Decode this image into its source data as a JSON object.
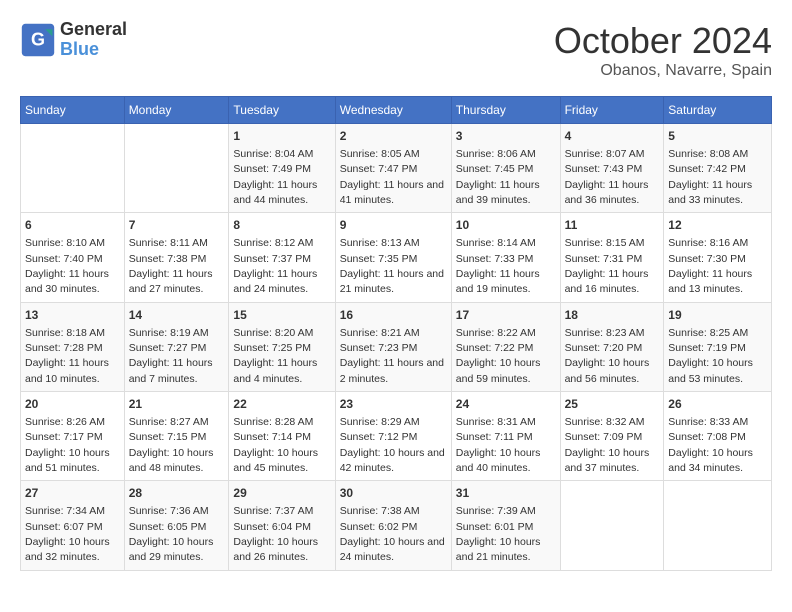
{
  "logo": {
    "line1": "General",
    "line2": "Blue"
  },
  "title": "October 2024",
  "location": "Obanos, Navarre, Spain",
  "days_of_week": [
    "Sunday",
    "Monday",
    "Tuesday",
    "Wednesday",
    "Thursday",
    "Friday",
    "Saturday"
  ],
  "weeks": [
    [
      {
        "day": "",
        "info": ""
      },
      {
        "day": "",
        "info": ""
      },
      {
        "day": "1",
        "info": "Sunrise: 8:04 AM\nSunset: 7:49 PM\nDaylight: 11 hours and 44 minutes."
      },
      {
        "day": "2",
        "info": "Sunrise: 8:05 AM\nSunset: 7:47 PM\nDaylight: 11 hours and 41 minutes."
      },
      {
        "day": "3",
        "info": "Sunrise: 8:06 AM\nSunset: 7:45 PM\nDaylight: 11 hours and 39 minutes."
      },
      {
        "day": "4",
        "info": "Sunrise: 8:07 AM\nSunset: 7:43 PM\nDaylight: 11 hours and 36 minutes."
      },
      {
        "day": "5",
        "info": "Sunrise: 8:08 AM\nSunset: 7:42 PM\nDaylight: 11 hours and 33 minutes."
      }
    ],
    [
      {
        "day": "6",
        "info": "Sunrise: 8:10 AM\nSunset: 7:40 PM\nDaylight: 11 hours and 30 minutes."
      },
      {
        "day": "7",
        "info": "Sunrise: 8:11 AM\nSunset: 7:38 PM\nDaylight: 11 hours and 27 minutes."
      },
      {
        "day": "8",
        "info": "Sunrise: 8:12 AM\nSunset: 7:37 PM\nDaylight: 11 hours and 24 minutes."
      },
      {
        "day": "9",
        "info": "Sunrise: 8:13 AM\nSunset: 7:35 PM\nDaylight: 11 hours and 21 minutes."
      },
      {
        "day": "10",
        "info": "Sunrise: 8:14 AM\nSunset: 7:33 PM\nDaylight: 11 hours and 19 minutes."
      },
      {
        "day": "11",
        "info": "Sunrise: 8:15 AM\nSunset: 7:31 PM\nDaylight: 11 hours and 16 minutes."
      },
      {
        "day": "12",
        "info": "Sunrise: 8:16 AM\nSunset: 7:30 PM\nDaylight: 11 hours and 13 minutes."
      }
    ],
    [
      {
        "day": "13",
        "info": "Sunrise: 8:18 AM\nSunset: 7:28 PM\nDaylight: 11 hours and 10 minutes."
      },
      {
        "day": "14",
        "info": "Sunrise: 8:19 AM\nSunset: 7:27 PM\nDaylight: 11 hours and 7 minutes."
      },
      {
        "day": "15",
        "info": "Sunrise: 8:20 AM\nSunset: 7:25 PM\nDaylight: 11 hours and 4 minutes."
      },
      {
        "day": "16",
        "info": "Sunrise: 8:21 AM\nSunset: 7:23 PM\nDaylight: 11 hours and 2 minutes."
      },
      {
        "day": "17",
        "info": "Sunrise: 8:22 AM\nSunset: 7:22 PM\nDaylight: 10 hours and 59 minutes."
      },
      {
        "day": "18",
        "info": "Sunrise: 8:23 AM\nSunset: 7:20 PM\nDaylight: 10 hours and 56 minutes."
      },
      {
        "day": "19",
        "info": "Sunrise: 8:25 AM\nSunset: 7:19 PM\nDaylight: 10 hours and 53 minutes."
      }
    ],
    [
      {
        "day": "20",
        "info": "Sunrise: 8:26 AM\nSunset: 7:17 PM\nDaylight: 10 hours and 51 minutes."
      },
      {
        "day": "21",
        "info": "Sunrise: 8:27 AM\nSunset: 7:15 PM\nDaylight: 10 hours and 48 minutes."
      },
      {
        "day": "22",
        "info": "Sunrise: 8:28 AM\nSunset: 7:14 PM\nDaylight: 10 hours and 45 minutes."
      },
      {
        "day": "23",
        "info": "Sunrise: 8:29 AM\nSunset: 7:12 PM\nDaylight: 10 hours and 42 minutes."
      },
      {
        "day": "24",
        "info": "Sunrise: 8:31 AM\nSunset: 7:11 PM\nDaylight: 10 hours and 40 minutes."
      },
      {
        "day": "25",
        "info": "Sunrise: 8:32 AM\nSunset: 7:09 PM\nDaylight: 10 hours and 37 minutes."
      },
      {
        "day": "26",
        "info": "Sunrise: 8:33 AM\nSunset: 7:08 PM\nDaylight: 10 hours and 34 minutes."
      }
    ],
    [
      {
        "day": "27",
        "info": "Sunrise: 7:34 AM\nSunset: 6:07 PM\nDaylight: 10 hours and 32 minutes."
      },
      {
        "day": "28",
        "info": "Sunrise: 7:36 AM\nSunset: 6:05 PM\nDaylight: 10 hours and 29 minutes."
      },
      {
        "day": "29",
        "info": "Sunrise: 7:37 AM\nSunset: 6:04 PM\nDaylight: 10 hours and 26 minutes."
      },
      {
        "day": "30",
        "info": "Sunrise: 7:38 AM\nSunset: 6:02 PM\nDaylight: 10 hours and 24 minutes."
      },
      {
        "day": "31",
        "info": "Sunrise: 7:39 AM\nSunset: 6:01 PM\nDaylight: 10 hours and 21 minutes."
      },
      {
        "day": "",
        "info": ""
      },
      {
        "day": "",
        "info": ""
      }
    ]
  ]
}
